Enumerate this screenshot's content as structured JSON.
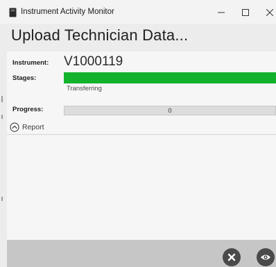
{
  "window": {
    "title": "Instrument Activity Monitor",
    "controls": {
      "minimize_icon": "minimize-icon",
      "maximize_icon": "maximize-icon",
      "close_icon": "close-icon"
    }
  },
  "header": {
    "title": "Upload Technician Data..."
  },
  "details": {
    "instrument_label": "Instrument:",
    "instrument_value": "V1000119",
    "stages_label": "Stages:",
    "stage_status": "Transferring",
    "progress_label": "Progress:",
    "progress_value": "0",
    "progress_fraction": 0
  },
  "report": {
    "label": "Report",
    "expanded": true,
    "icon": "chevron-up-circle-icon"
  },
  "footer": {
    "cancel_icon": "cancel-icon",
    "view_icon": "eye-icon"
  },
  "colors": {
    "accent_green": "#12b22c",
    "title_bar": "#f3f3f3",
    "background": "#ececec",
    "panel": "#f6f6f6",
    "footer": "#c6c6c6",
    "button": "#4a4a4a"
  }
}
